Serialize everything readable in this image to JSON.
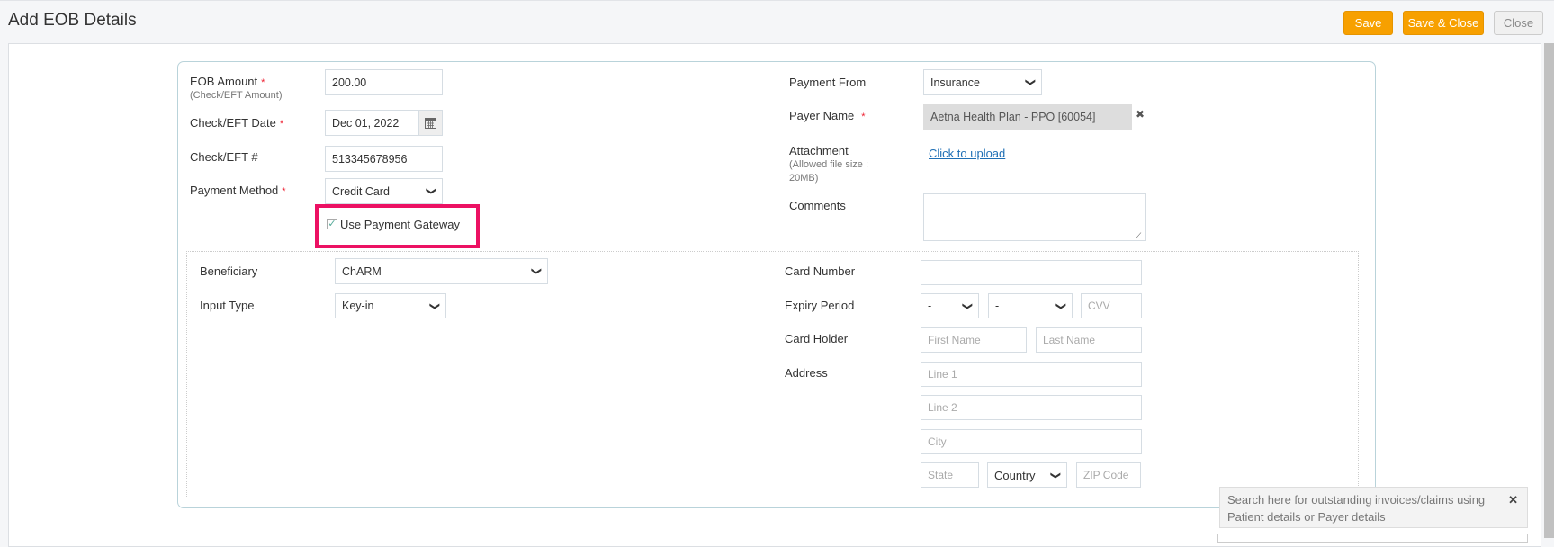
{
  "header": {
    "title": "Add EOB Details",
    "save": "Save",
    "save_close": "Save & Close",
    "close": "Close"
  },
  "left": {
    "eob_amount": {
      "label": "EOB Amount",
      "hint": "(Check/EFT Amount)",
      "value": "200.00",
      "required": "*"
    },
    "date": {
      "label": "Check/EFT Date",
      "value": "Dec 01, 2022",
      "required": "*"
    },
    "check_no": {
      "label": "Check/EFT #",
      "value": "513345678956"
    },
    "payment_method": {
      "label": "Payment Method",
      "value": "Credit Card",
      "required": "*"
    },
    "gateway": {
      "label": "Use Payment Gateway",
      "checked": true,
      "check": "✓"
    }
  },
  "right": {
    "payment_from": {
      "label": "Payment From",
      "value": "Insurance"
    },
    "payer": {
      "label": "Payer Name",
      "value": "Aetna Health Plan - PPO [60054]",
      "required": "*",
      "clear": "✖"
    },
    "attachment": {
      "label": "Attachment",
      "hint1": "(Allowed file size :",
      "hint2": "20MB)",
      "link": "Click to upload"
    },
    "comments": {
      "label": "Comments",
      "value": ""
    }
  },
  "gateway": {
    "beneficiary": {
      "label": "Beneficiary",
      "value": "ChARM"
    },
    "input_type": {
      "label": "Input Type",
      "value": "Key-in"
    },
    "card_number": {
      "label": "Card Number",
      "value": ""
    },
    "expiry": {
      "label": "Expiry Period",
      "month": "-",
      "year": "-",
      "cvv_placeholder": "CVV"
    },
    "holder": {
      "label": "Card Holder",
      "first_placeholder": "First Name",
      "last_placeholder": "Last Name"
    },
    "address": {
      "label": "Address",
      "line1": "Line 1",
      "line2": "Line 2",
      "city": "City",
      "state": "State",
      "country": "Country",
      "zip": "ZIP Code"
    }
  },
  "tooltip": {
    "text": "Search here for outstanding invoices/claims using Patient details or Payer details",
    "close": "✕"
  },
  "chevron": "❯"
}
